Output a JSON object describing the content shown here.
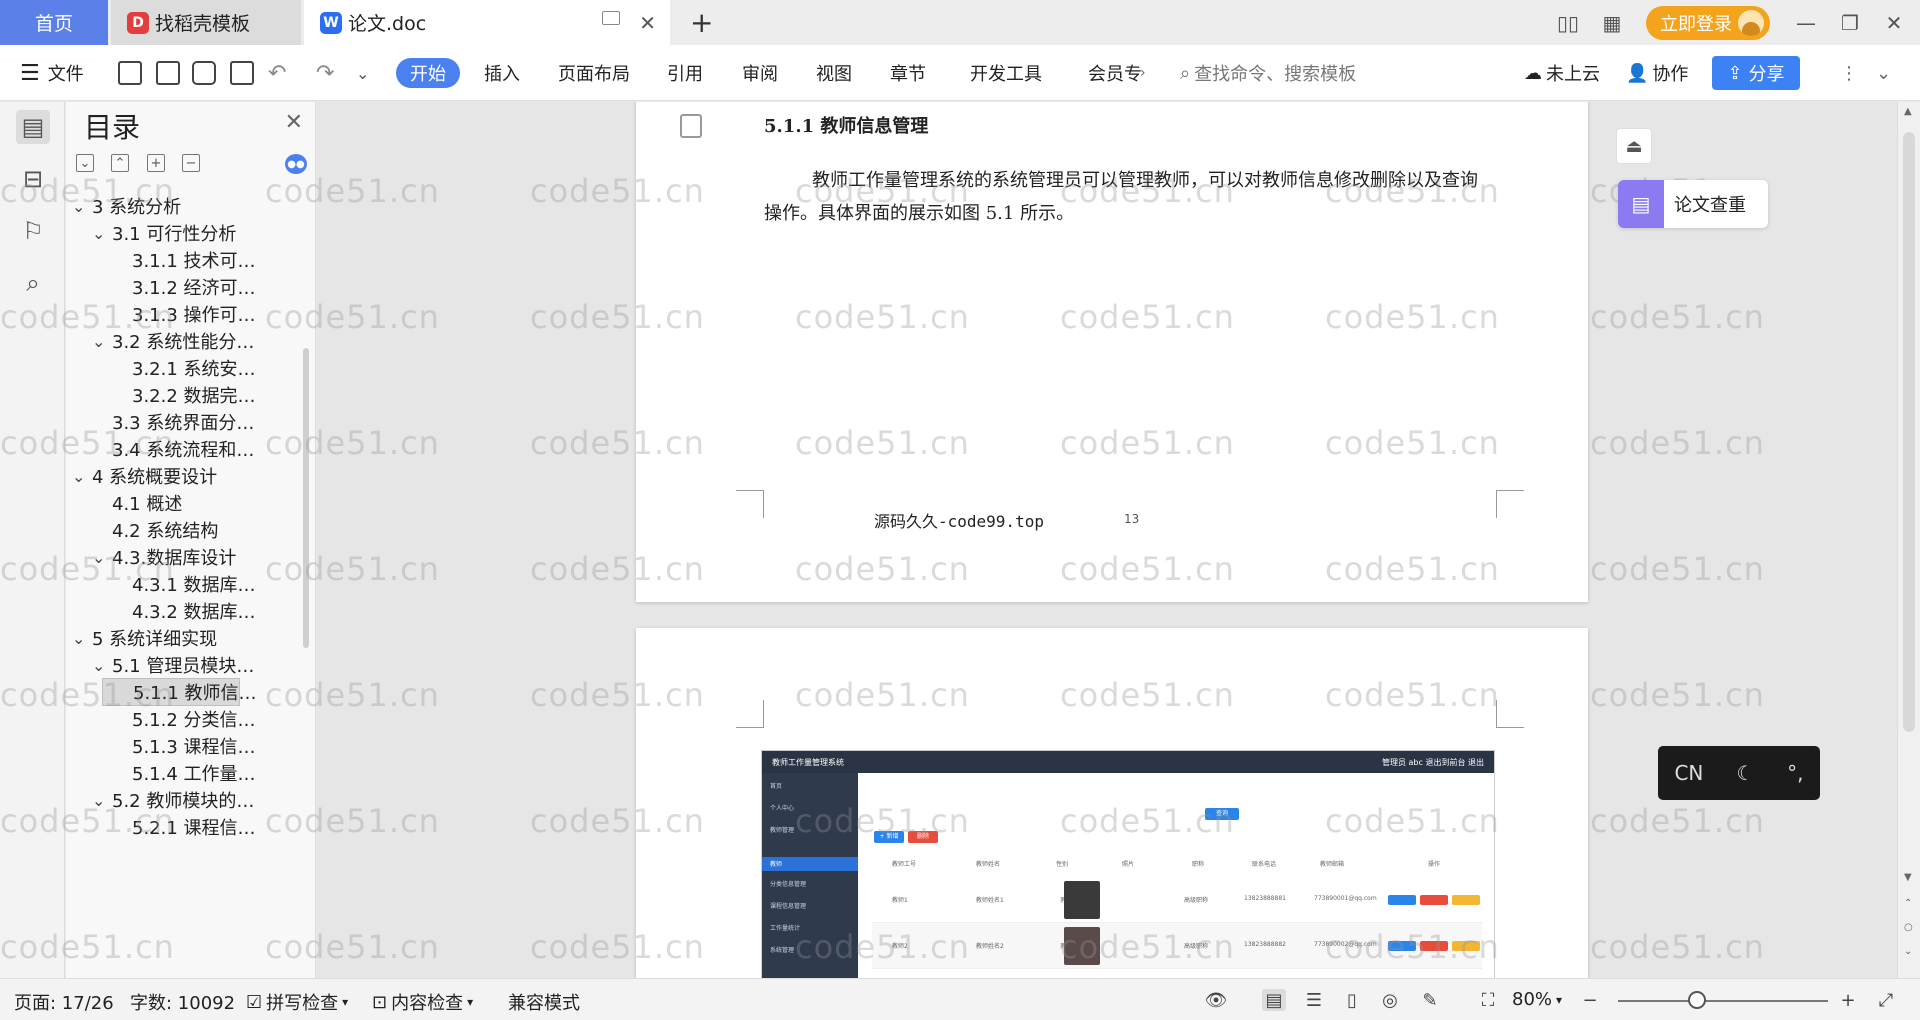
{
  "tabs": {
    "home": "首页",
    "template": "找稻壳模板",
    "document": "论文.doc",
    "add": "+"
  },
  "window": {
    "login": "立即登录"
  },
  "ribbon": {
    "menu_file": "文件",
    "start": "开始",
    "insert": "插入",
    "layout": "页面布局",
    "reference": "引用",
    "review": "审阅",
    "view": "视图",
    "chapter": "章节",
    "dev_tools": "开发工具",
    "member": "会员专",
    "search_placeholder": "查找命令、搜索模板",
    "cloud": "未上云",
    "collab": "协作",
    "share": "分享"
  },
  "toc": {
    "title": "目录",
    "items": [
      {
        "label": "3 系统分析",
        "level": 0,
        "expanded": true
      },
      {
        "label": "3.1 可行性分析",
        "level": 1,
        "expanded": true
      },
      {
        "label": "3.1.1 技术可…",
        "level": 2
      },
      {
        "label": "3.1.2 经济可…",
        "level": 2
      },
      {
        "label": "3.1.3 操作可…",
        "level": 2
      },
      {
        "label": "3.2 系统性能分…",
        "level": 1,
        "expanded": true
      },
      {
        "label": "3.2.1  系统安…",
        "level": 2
      },
      {
        "label": "3.2.2  数据完…",
        "level": 2
      },
      {
        "label": "3.3 系统界面分…",
        "level": 1
      },
      {
        "label": "3.4 系统流程和…",
        "level": 1
      },
      {
        "label": "4 系统概要设计",
        "level": 0,
        "expanded": true
      },
      {
        "label": "4.1 概述",
        "level": 1
      },
      {
        "label": "4.2 系统结构",
        "level": 1
      },
      {
        "label": "4.3.数据库设计",
        "level": 1,
        "expanded": true
      },
      {
        "label": "4.3.1 数据库…",
        "level": 2
      },
      {
        "label": "4.3.2 数据库…",
        "level": 2
      },
      {
        "label": "5 系统详细实现",
        "level": 0,
        "expanded": true
      },
      {
        "label": "5.1  管理员模块…",
        "level": 1,
        "expanded": true
      },
      {
        "label": "5.1.1  教师信…",
        "level": 2,
        "selected": true
      },
      {
        "label": "5.1.2  分类信…",
        "level": 2
      },
      {
        "label": "5.1.3  课程信…",
        "level": 2
      },
      {
        "label": "5.1.4  工作量…",
        "level": 2
      },
      {
        "label": "5.2  教师模块的…",
        "level": 1,
        "expanded": true
      },
      {
        "label": "5.2.1  课程信…",
        "level": 2
      }
    ]
  },
  "document": {
    "heading": "5.1.1  教师信息管理",
    "body": "教师工作量管理系统的系统管理员可以管理教师，可以对教师信息修改删除以及查询操作。具体界面的展示如图 5.1 所示。",
    "footer": "源码久久-code99.top",
    "page_number": "13",
    "watermark": "code51.cn"
  },
  "figure": {
    "app_title": "教师工作量管理系统",
    "top_right": "管理员 abc   退出到前台   退出",
    "menu": [
      "首页",
      "个人中心",
      "教师管理",
      "教师",
      "分类信息管理",
      "课程信息管理",
      "工作量统计",
      "系统管理"
    ],
    "search_btn": "查询",
    "add_btn": "+ 新增",
    "del_btn": "删除",
    "headers": [
      "教师工号",
      "教师姓名",
      "性别",
      "照片",
      "职称",
      "联系电话",
      "教师邮箱",
      "操作"
    ],
    "rows": [
      {
        "id": "教师1",
        "name": "教师姓名1",
        "sex": "男",
        "title": "高级职称",
        "phone": "13823888881",
        "email": "773890001@qq.com"
      },
      {
        "id": "教师2",
        "name": "教师姓名2",
        "sex": "男",
        "title": "高级职称",
        "phone": "13823888882",
        "email": "773890002@qq.com"
      }
    ]
  },
  "right_panel": {
    "paper_check": "论文查重",
    "ime_cn": "CN",
    "ime_moon": "☾",
    "ime_punct": "°,"
  },
  "status": {
    "page": "页面: 17/26",
    "words": "字数: 10092",
    "spell": "拼写检查",
    "content_check": "内容检查",
    "compat": "兼容模式",
    "zoom": "80%"
  },
  "colors": {
    "accent": "#4a80f0",
    "home_tab": "#5b81e8",
    "login": "#f3a31c"
  }
}
